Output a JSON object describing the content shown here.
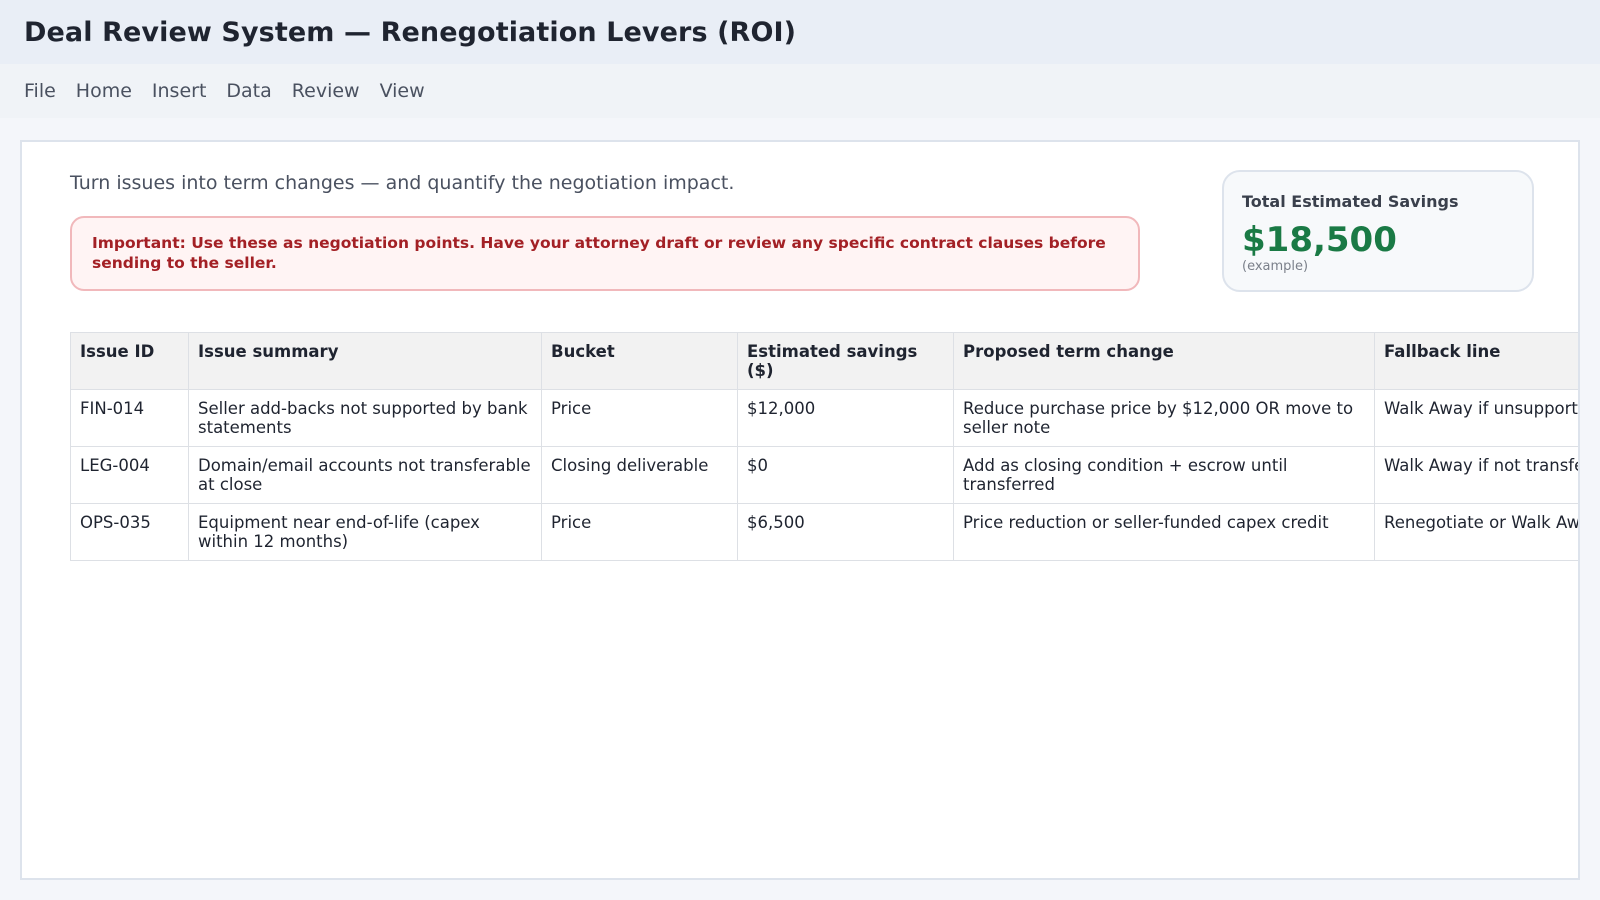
{
  "window": {
    "title": "Deal Review System — Renegotiation Levers (ROI)"
  },
  "menu": [
    "File",
    "Home",
    "Insert",
    "Data",
    "Review",
    "View"
  ],
  "intro": "Turn issues into term changes — and quantify the negotiation impact.",
  "warning": "Important: Use these as negotiation points. Have your attorney draft or review any specific contract clauses before sending to the seller.",
  "kpi": {
    "title": "Total Estimated Savings",
    "value": "$18,500",
    "note": "(example)",
    "value_color": "#1a7a45"
  },
  "table": {
    "headers": [
      "Issue ID",
      "Issue summary",
      "Bucket",
      "Estimated savings ($)",
      "Proposed term change",
      "Fallback line"
    ],
    "rows": [
      [
        "FIN-014",
        "Seller add-backs not supported by bank statements",
        "Price",
        "$12,000",
        "Reduce purchase price by $12,000 OR move to seller note",
        "Walk Away if unsupported"
      ],
      [
        "LEG-004",
        "Domain/email accounts not transferable at close",
        "Closing deliverable",
        "$0",
        "Add as closing condition + escrow until transferred",
        "Walk Away if not transferred"
      ],
      [
        "OPS-035",
        "Equipment near end-of-life (capex within 12 months)",
        "Price",
        "$6,500",
        "Price reduction or seller-funded capex credit",
        "Renegotiate or Walk Away"
      ]
    ]
  },
  "colors": {
    "warning_text": "#a32025",
    "warning_bg": "#fff4f4",
    "savings_green": "#1a7a45"
  }
}
